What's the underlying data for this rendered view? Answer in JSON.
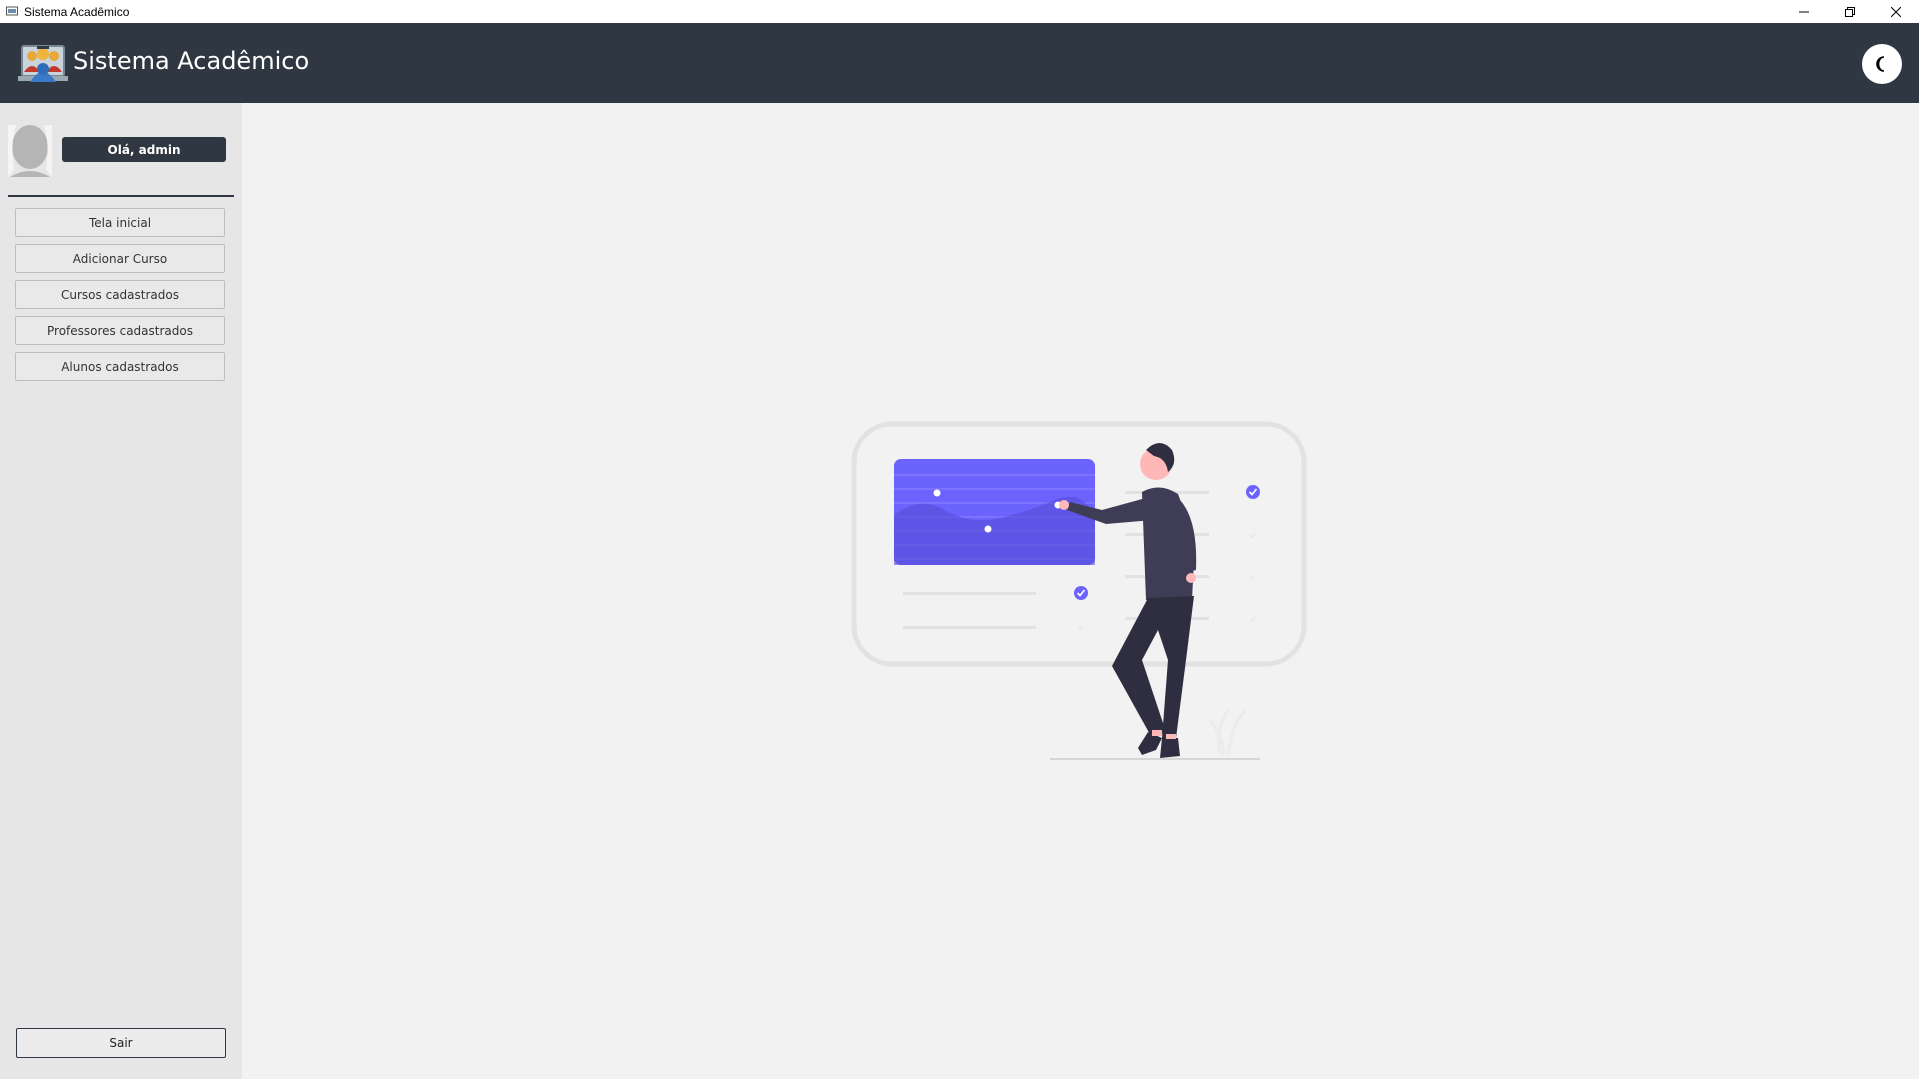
{
  "window": {
    "title": "Sistema Acadêmico"
  },
  "header": {
    "title": "Sistema Acadêmico",
    "theme_icon": "moon-icon"
  },
  "sidebar": {
    "greeting": "Olá, admin",
    "items": [
      {
        "label": "Tela inicial"
      },
      {
        "label": "Adicionar Curso"
      },
      {
        "label": "Cursos cadastrados"
      },
      {
        "label": "Professores cadastrados"
      },
      {
        "label": "Alunos cadastrados"
      }
    ],
    "logout": "Sair"
  },
  "colors": {
    "header_bg": "#2f3842",
    "accent": "#6c63ff",
    "sidebar_bg": "#e6e6e6",
    "content_bg": "#f2f2f2"
  }
}
